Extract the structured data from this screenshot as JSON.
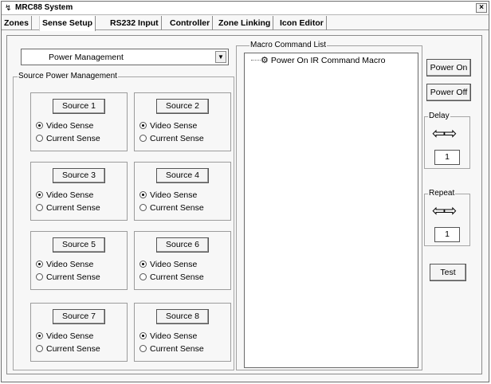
{
  "window": {
    "title": "MRC88 System",
    "close_glyph": "×"
  },
  "tabs": [
    "Zones",
    "Sense Setup",
    "RS232 Input",
    "Controller",
    "Zone Linking",
    "Icon Editor"
  ],
  "dropdown": {
    "value": "Power Management"
  },
  "source_group_label": "Source Power Management",
  "sources": [
    {
      "label": "Source 1",
      "video": "Video Sense",
      "current": "Current Sense",
      "selected": "video"
    },
    {
      "label": "Source 2",
      "video": "Video Sense",
      "current": "Current Sense",
      "selected": "video"
    },
    {
      "label": "Source 3",
      "video": "Video Sense",
      "current": "Current Sense",
      "selected": "video"
    },
    {
      "label": "Source 4",
      "video": "Video Sense",
      "current": "Current Sense",
      "selected": "video"
    },
    {
      "label": "Source 5",
      "video": "Video Sense",
      "current": "Current Sense",
      "selected": "video"
    },
    {
      "label": "Source 6",
      "video": "Video Sense",
      "current": "Current Sense",
      "selected": "video"
    },
    {
      "label": "Source 7",
      "video": "Video Sense",
      "current": "Current Sense",
      "selected": "video"
    },
    {
      "label": "Source 8",
      "video": "Video Sense",
      "current": "Current Sense",
      "selected": "video"
    }
  ],
  "macro": {
    "group_label": "Macro Command List",
    "items": [
      {
        "label": "Power On IR Command Macro",
        "icon": "macro-icon"
      }
    ]
  },
  "buttons": {
    "power_on": "Power On",
    "power_off": "Power Off",
    "test": "Test"
  },
  "delay": {
    "label": "Delay",
    "value": "1"
  },
  "repeat": {
    "label": "Repeat",
    "value": "1"
  },
  "arrow_glyphs": "⇦⇨"
}
